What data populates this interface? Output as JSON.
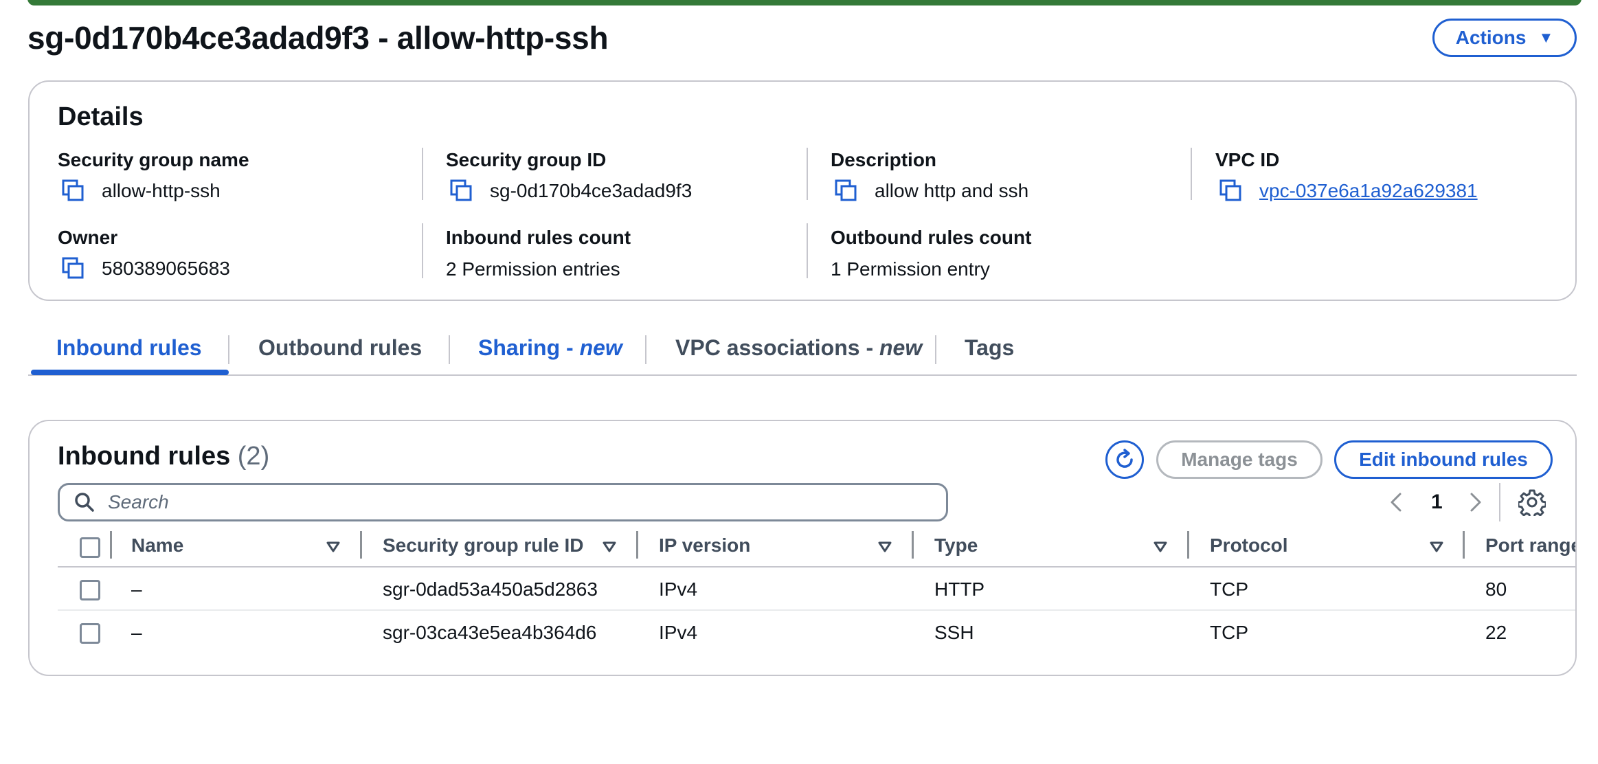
{
  "page": {
    "title": "sg-0d170b4ce3adad9f3 - allow-http-ssh",
    "actions_label": "Actions",
    "accent_color": "#1f5fd1",
    "status_bar_color": "#347a38"
  },
  "details": {
    "heading": "Details",
    "security_group_name": {
      "label": "Security group name",
      "value": "allow-http-ssh"
    },
    "security_group_id": {
      "label": "Security group ID",
      "value": "sg-0d170b4ce3adad9f3"
    },
    "description": {
      "label": "Description",
      "value": "allow http and ssh"
    },
    "vpc_id": {
      "label": "VPC ID",
      "value": "vpc-037e6a1a92a629381"
    },
    "owner": {
      "label": "Owner",
      "value": "580389065683"
    },
    "inbound_rules_count": {
      "label": "Inbound rules count",
      "value": "2 Permission entries"
    },
    "outbound_rules_count": {
      "label": "Outbound rules count",
      "value": "1 Permission entry"
    }
  },
  "tabs": [
    {
      "label": "Inbound rules",
      "active": true
    },
    {
      "label": "Outbound rules"
    },
    {
      "label": "Sharing - ",
      "suffix": "new"
    },
    {
      "label": "VPC associations - ",
      "suffix": "new"
    },
    {
      "label": "Tags"
    }
  ],
  "inbound_rules": {
    "heading": "Inbound rules",
    "count": "(2)",
    "manage_tags_label": "Manage tags",
    "edit_label": "Edit inbound rules",
    "search_placeholder": "Search",
    "page_number": "1",
    "columns": [
      "Name",
      "Security group rule ID",
      "IP version",
      "Type",
      "Protocol",
      "Port range"
    ],
    "rows": [
      {
        "name": "–",
        "rule_id": "sgr-0dad53a450a5d2863",
        "ip_version": "IPv4",
        "type": "HTTP",
        "protocol": "TCP",
        "port_range": "80"
      },
      {
        "name": "–",
        "rule_id": "sgr-03ca43e5ea4b364d6",
        "ip_version": "IPv4",
        "type": "SSH",
        "protocol": "TCP",
        "port_range": "22"
      }
    ]
  }
}
